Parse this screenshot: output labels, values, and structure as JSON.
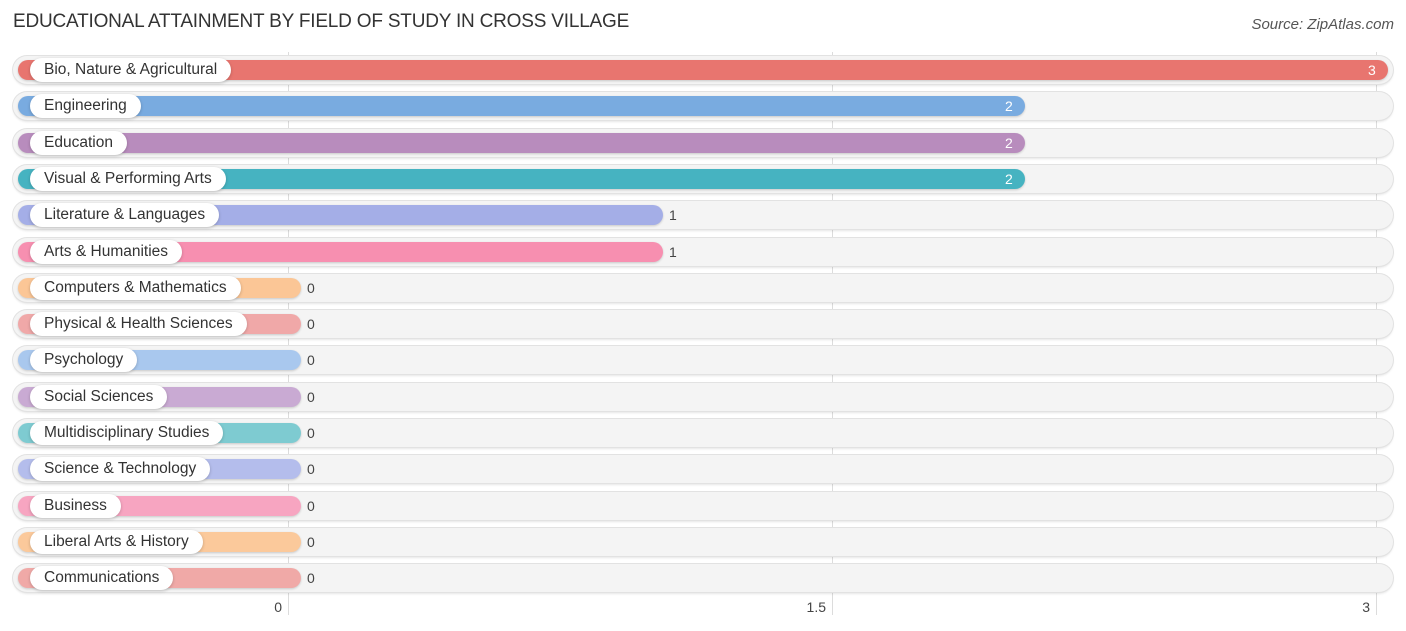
{
  "title": "EDUCATIONAL ATTAINMENT BY FIELD OF STUDY IN CROSS VILLAGE",
  "source": "Source: ZipAtlas.com",
  "chart_data": {
    "type": "bar",
    "orientation": "horizontal",
    "title": "EDUCATIONAL ATTAINMENT BY FIELD OF STUDY IN CROSS VILLAGE",
    "xlabel": "",
    "ylabel": "",
    "xlim": [
      0,
      3
    ],
    "grid": true,
    "legend": "none",
    "x_ticks": [
      "0",
      "1.5",
      "3"
    ],
    "x_tick_values": [
      0,
      1.5,
      3
    ],
    "categories": [
      "Bio, Nature & Agricultural",
      "Engineering",
      "Education",
      "Visual & Performing Arts",
      "Literature & Languages",
      "Arts & Humanities",
      "Computers & Mathematics",
      "Physical & Health Sciences",
      "Psychology",
      "Social Sciences",
      "Multidisciplinary Studies",
      "Science & Technology",
      "Business",
      "Liberal Arts & History",
      "Communications"
    ],
    "values": [
      3,
      2,
      2,
      2,
      1,
      1,
      0,
      0,
      0,
      0,
      0,
      0,
      0,
      0,
      0
    ],
    "value_labels": [
      "3",
      "2",
      "2",
      "2",
      "1",
      "1",
      "0",
      "0",
      "0",
      "0",
      "0",
      "0",
      "0",
      "0",
      "0"
    ],
    "colors": [
      "#e8756f",
      "#79abe0",
      "#b88cbd",
      "#46b3c1",
      "#a4aee7",
      "#f78fb0",
      "#fbc696",
      "#f0a8a8",
      "#a9c8ee",
      "#c9aad3",
      "#7ecbd1",
      "#b4bdec",
      "#f7a5c1",
      "#fbc99b",
      "#f0a9a7"
    ]
  }
}
